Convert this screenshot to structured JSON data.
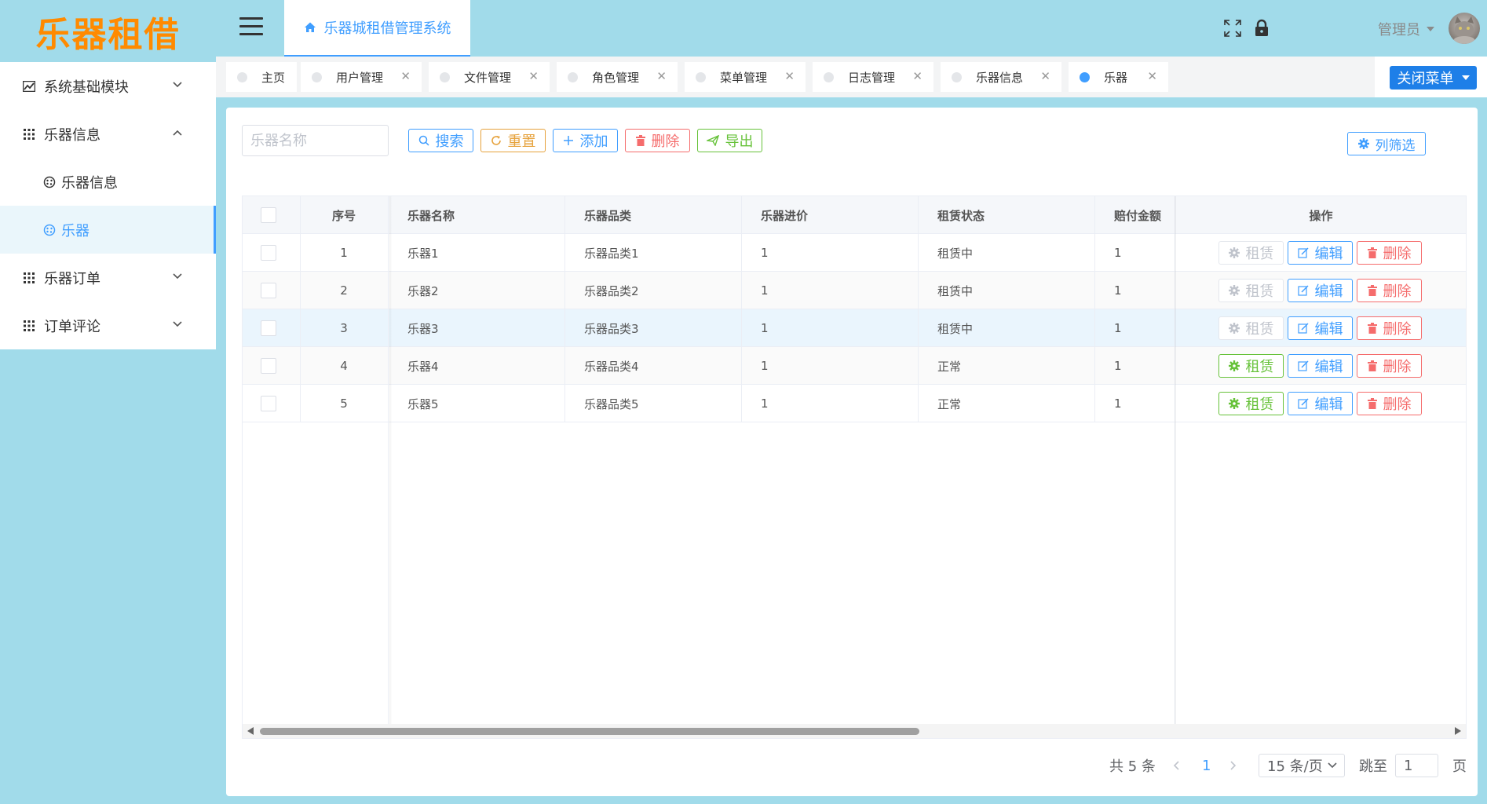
{
  "app": {
    "logo": "乐器租借"
  },
  "sidebar": {
    "items": [
      {
        "label": "系统基础模块",
        "icon": "chart-icon",
        "expanded": false
      },
      {
        "label": "乐器信息",
        "icon": "grid-icon",
        "expanded": true,
        "children": [
          {
            "label": "乐器信息",
            "icon": "palette-icon",
            "active": false
          },
          {
            "label": "乐器",
            "icon": "palette-icon",
            "active": true
          }
        ]
      },
      {
        "label": "乐器订单",
        "icon": "grid-icon",
        "expanded": false
      },
      {
        "label": "订单评论",
        "icon": "grid-icon",
        "expanded": false
      }
    ]
  },
  "header": {
    "tab_label": "乐器城租借管理系统",
    "username": "管理员"
  },
  "tags": {
    "items": [
      {
        "label": "主页",
        "closable": false,
        "active": false
      },
      {
        "label": "用户管理",
        "closable": true,
        "active": false
      },
      {
        "label": "文件管理",
        "closable": true,
        "active": false
      },
      {
        "label": "角色管理",
        "closable": true,
        "active": false
      },
      {
        "label": "菜单管理",
        "closable": true,
        "active": false
      },
      {
        "label": "日志管理",
        "closable": true,
        "active": false
      },
      {
        "label": "乐器信息",
        "closable": true,
        "active": false
      },
      {
        "label": "乐器",
        "closable": true,
        "active": true
      }
    ],
    "close_menu_label": "关闭菜单",
    "close_symbol": "✕"
  },
  "toolbar": {
    "search_placeholder": "乐器名称",
    "search_label": "搜索",
    "reset_label": "重置",
    "add_label": "添加",
    "delete_label": "删除",
    "export_label": "导出",
    "columns_label": "列筛选"
  },
  "table": {
    "headers": [
      "序号",
      "乐器名称",
      "乐器品类",
      "乐器进价",
      "租赁状态",
      "赔付金额",
      "操作"
    ],
    "rows": [
      {
        "index": "1",
        "name": "乐器1",
        "category": "乐器品类1",
        "price": "1",
        "status": "租赁中",
        "compensation": "1",
        "rent_enabled": false
      },
      {
        "index": "2",
        "name": "乐器2",
        "category": "乐器品类2",
        "price": "1",
        "status": "租赁中",
        "compensation": "1",
        "rent_enabled": false
      },
      {
        "index": "3",
        "name": "乐器3",
        "category": "乐器品类3",
        "price": "1",
        "status": "租赁中",
        "compensation": "1",
        "rent_enabled": false
      },
      {
        "index": "4",
        "name": "乐器4",
        "category": "乐器品类4",
        "price": "1",
        "status": "正常",
        "compensation": "1",
        "rent_enabled": true
      },
      {
        "index": "5",
        "name": "乐器5",
        "category": "乐器品类5",
        "price": "1",
        "status": "正常",
        "compensation": "1",
        "rent_enabled": true
      }
    ],
    "actions": {
      "rent": "租赁",
      "edit": "编辑",
      "delete": "删除"
    }
  },
  "pagination": {
    "total_text": "共 5 条",
    "current_page": "1",
    "page_size": "15 条/页",
    "jump_label": "跳至",
    "jump_value": "1",
    "page_unit": "页"
  },
  "colors": {
    "primary": "#409eff",
    "warning": "#e6a23c",
    "danger": "#f56c6c",
    "success": "#67c23a",
    "logo": "#ff8a00",
    "header_bg": "#a1dbea"
  }
}
